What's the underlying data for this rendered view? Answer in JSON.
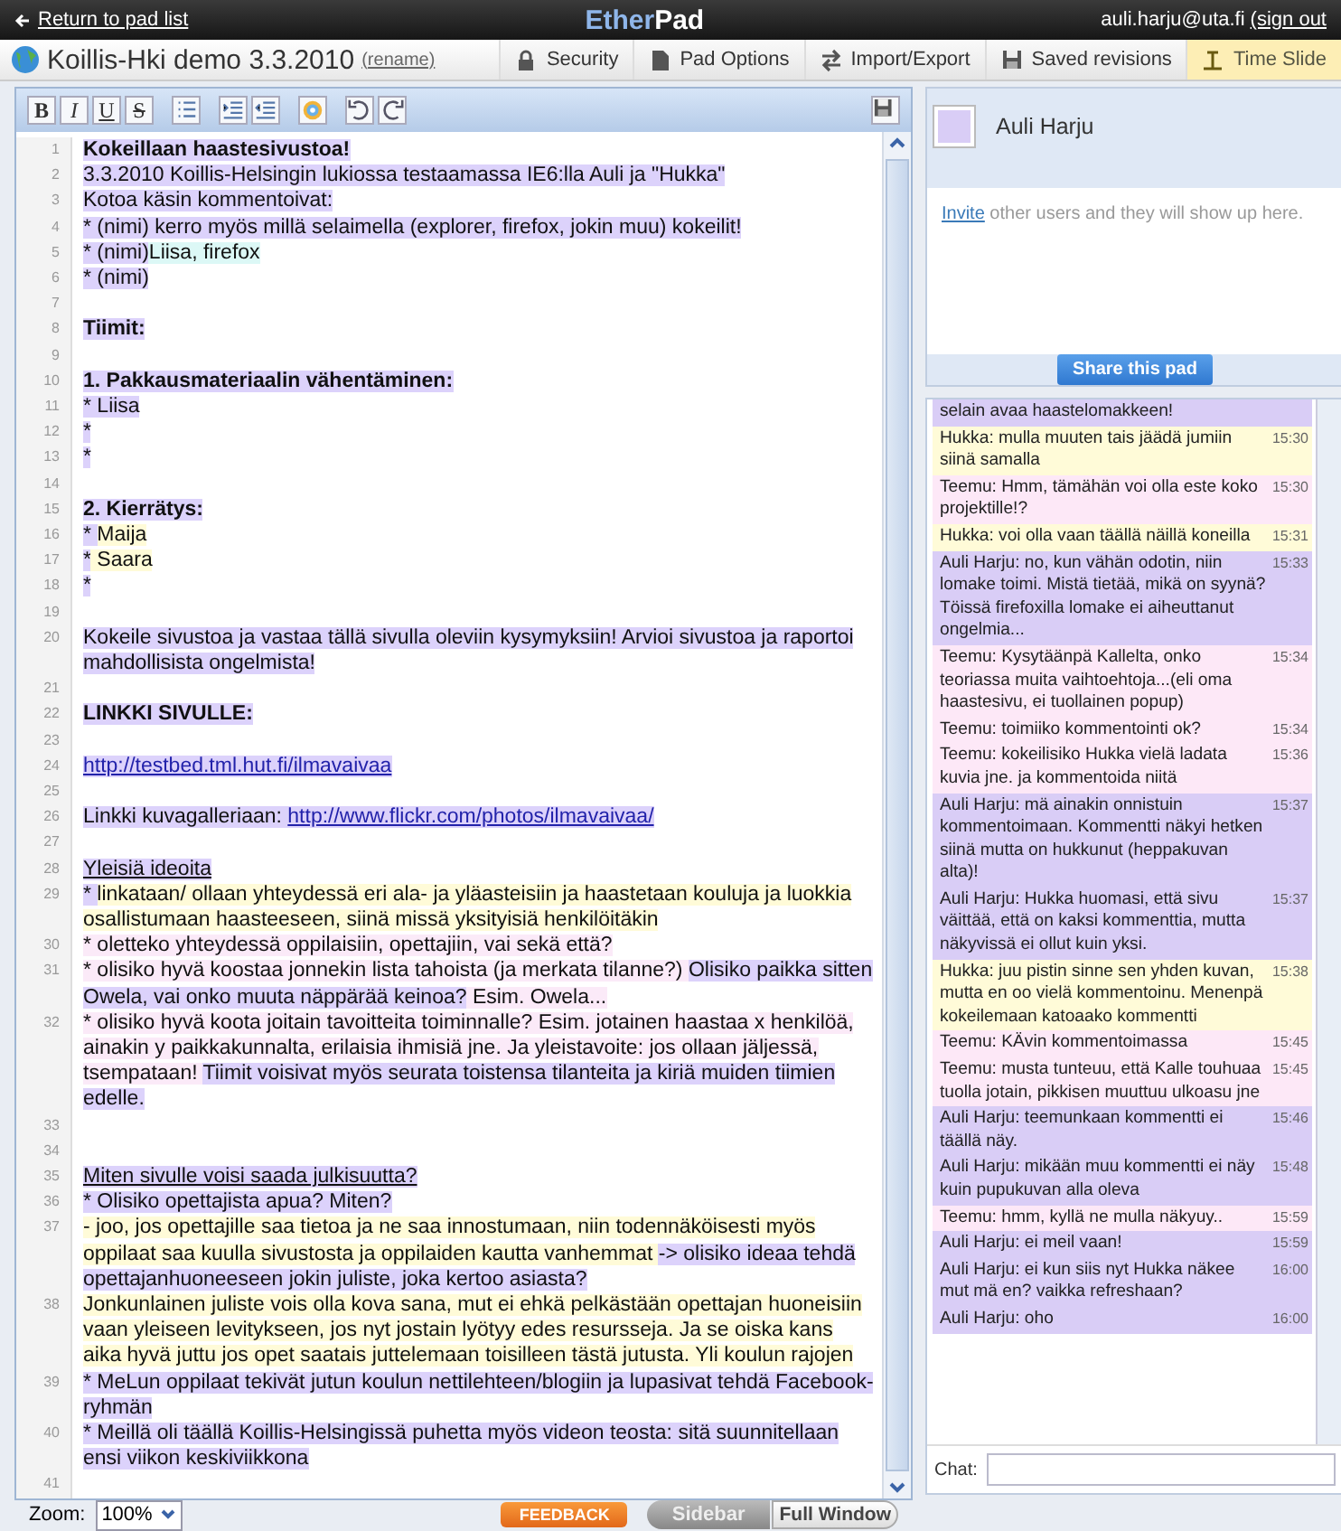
{
  "header": {
    "back_link": "Return to pad list",
    "logo_left": "Ether",
    "logo_right": "Pad",
    "user_email": "auli.harju@uta.fi",
    "sign_out": "(sign out"
  },
  "pad": {
    "title": "Koillis-Hki demo 3.3.2010",
    "rename": "(rename)"
  },
  "menu": [
    {
      "label": "Security",
      "kind": "lock",
      "selected": false
    },
    {
      "label": "Pad Options",
      "kind": "page",
      "selected": false
    },
    {
      "label": "Import/Export",
      "kind": "arrows",
      "selected": false
    },
    {
      "label": "Saved revisions",
      "kind": "floppy",
      "selected": false
    },
    {
      "label": "Time Slide",
      "kind": "slider",
      "selected": true
    }
  ],
  "toolbar": [
    {
      "kind": "bold",
      "label": "B"
    },
    {
      "kind": "italic",
      "label": "I"
    },
    {
      "kind": "underline",
      "label": "U"
    },
    {
      "kind": "strike",
      "label": "S"
    },
    {
      "kind": "bullets"
    },
    {
      "kind": "indent"
    },
    {
      "kind": "outdent"
    },
    {
      "kind": "color"
    },
    {
      "kind": "undo"
    },
    {
      "kind": "redo"
    }
  ],
  "editor": {
    "lines": [
      {
        "number": "1",
        "segments": [
          {
            "text": "Kokeillaan haastesivustoa!",
            "kind": "bold",
            "color": "#dcd2fb"
          }
        ]
      },
      {
        "number": "2",
        "segments": [
          {
            "text": "3.3.2010 Koillis-Helsingin lukiossa testaamassa IE6:lla Auli ja \"Hukka\"",
            "kind": "plain",
            "color": "#dcd2fb"
          }
        ]
      },
      {
        "number": "3",
        "segments": [
          {
            "text": "Kotoa käsin kommentoivat:",
            "kind": "plain",
            "color": "#dcd2fb"
          }
        ]
      },
      {
        "number": "4",
        "segments": [
          {
            "text": "* (nimi) kerro myös millä selaimella (explorer, firefox, jokin muu) kokeilit!",
            "kind": "plain",
            "color": "#dcd2fb"
          }
        ]
      },
      {
        "number": "5",
        "segments": [
          {
            "text": "* (nimi)",
            "kind": "plain",
            "color": "#dcd2fb"
          },
          {
            "text": "Liisa, firefox",
            "kind": "plain",
            "color": "#dcf8f6"
          }
        ]
      },
      {
        "number": "6",
        "segments": [
          {
            "text": "* (nimi)",
            "kind": "plain",
            "color": "#dcd2fb"
          }
        ]
      },
      {
        "number": "7"
      },
      {
        "number": "8",
        "segments": [
          {
            "text": "Tiimit:",
            "kind": "bold",
            "color": "#dcd2fb"
          }
        ]
      },
      {
        "number": "9"
      },
      {
        "number": "10",
        "segments": [
          {
            "text": "1. Pakkausmateriaalin vähentäminen:",
            "kind": "bold",
            "color": "#dcd2fb"
          }
        ]
      },
      {
        "number": "11",
        "segments": [
          {
            "text": "* Liisa",
            "kind": "plain",
            "color": "#dcd2fb"
          }
        ]
      },
      {
        "number": "12",
        "segments": [
          {
            "text": "*",
            "kind": "plain",
            "color": "#dcd2fb"
          }
        ]
      },
      {
        "number": "13",
        "segments": [
          {
            "text": "*",
            "kind": "plain",
            "color": "#dcd2fb"
          }
        ]
      },
      {
        "number": "14"
      },
      {
        "number": "15",
        "segments": [
          {
            "text": "2. Kierrätys:",
            "kind": "bold",
            "color": "#dcd2fb"
          }
        ]
      },
      {
        "number": "16",
        "segments": [
          {
            "text": "* ",
            "kind": "plain",
            "color": "#dcd2fb"
          },
          {
            "text": "Maija",
            "kind": "plain",
            "color": "#fffbd8"
          }
        ]
      },
      {
        "number": "17",
        "segments": [
          {
            "text": "*",
            "kind": "plain",
            "color": "#dcd2fb"
          },
          {
            "text": " Saara",
            "kind": "plain",
            "color": "#fffbd8"
          }
        ]
      },
      {
        "number": "18",
        "segments": [
          {
            "text": "*",
            "kind": "plain",
            "color": "#dcd2fb"
          }
        ]
      },
      {
        "number": "19"
      },
      {
        "number": "20",
        "segments": [
          {
            "text": "Kokeile sivustoa ja vastaa tällä sivulla oleviin kysymyksiin! Arvioi sivustoa ja raportoi mahdollisista ongelmista!",
            "kind": "plain",
            "color": "#dcd2fb"
          }
        ]
      },
      {
        "number": "21"
      },
      {
        "number": "22",
        "segments": [
          {
            "text": "LINKKI SIVULLE:",
            "kind": "bold",
            "color": "#dcd2fb"
          }
        ]
      },
      {
        "number": "23"
      },
      {
        "number": "24",
        "segments": [
          {
            "text": "http://testbed.tml.hut.fi/ilmavaivaa",
            "kind": "link",
            "color": "#dcd2fb"
          }
        ]
      },
      {
        "number": "25"
      },
      {
        "number": "26",
        "segments": [
          {
            "text": "Linkki kuvagalleriaan: ",
            "kind": "plain",
            "color": "#dcd2fb"
          },
          {
            "text": "http://www.flickr.com/photos/ilmavaivaa/",
            "kind": "link",
            "color": "#dcd2fb"
          }
        ]
      },
      {
        "number": "27"
      },
      {
        "number": "28",
        "segments": [
          {
            "text": "Yleisiä ideoita",
            "kind": "underline",
            "color": "#dcd2fb"
          }
        ]
      },
      {
        "number": "29",
        "segments": [
          {
            "text": "* ",
            "kind": "plain",
            "color": "#dcd2fb"
          },
          {
            "text": "linkataan/ ollaan yhteydessä eri ala- ja yläasteisiin ja haastetaan kouluja ja luokkia osallistumaan haasteeseen, siinä missä yksityisiä henkilöitäkin",
            "kind": "plain",
            "color": "#fffbd8"
          }
        ]
      },
      {
        "number": "30",
        "segments": [
          {
            "text": "* oletteko yhteydessä oppilaisiin, opettajiin, vai sekä että?",
            "kind": "plain",
            "color": "#fbeaf8"
          }
        ]
      },
      {
        "number": "31",
        "segments": [
          {
            "text": "* olisiko hyvä koostaa jonnekin lista tahoista (ja merkata tilanne?) ",
            "kind": "plain",
            "color": "#fbeaf8"
          },
          {
            "text": "Olisiko paikka sitten Owela, vai onko muuta näppärää keinoa?",
            "kind": "plain",
            "color": "#dcd2fb"
          },
          {
            "text": " Esim. Owela...",
            "kind": "plain",
            "color": "#fbeaf8"
          }
        ]
      },
      {
        "number": "32",
        "segments": [
          {
            "text": "* olisiko hyvä koota joitain tavoitteita toiminnalle? Esim. jotainen haastaa x henkilöä, ainakin y paikkakunnalta, erilaisia ihmisiä jne. Ja yleistavoite: jos ollaan jäljessä, tsempataan! ",
            "kind": "plain",
            "color": "#fbeaf8"
          },
          {
            "text": "Tiimit voisivat myös seurata toistensa tilanteita ja kiriä muiden tiimien edelle.",
            "kind": "plain",
            "color": "#dcd2fb"
          }
        ]
      },
      {
        "number": "33"
      },
      {
        "number": "34"
      },
      {
        "number": "35",
        "segments": [
          {
            "text": "Miten sivulle voisi saada julkisuutta?",
            "kind": "underline",
            "color": "#dcd2fb"
          }
        ]
      },
      {
        "number": "36",
        "segments": [
          {
            "text": "* Olisiko opettajista apua? Miten?",
            "kind": "plain",
            "color": "#dcd2fb"
          }
        ]
      },
      {
        "number": "37",
        "segments": [
          {
            "text": "- joo, jos opettajille saa tietoa ja ne saa innostumaan, niin todennäköisesti myös oppilaat saa kuulla sivustosta ja oppilaiden kautta vanhemmat ",
            "kind": "plain",
            "color": "#fffbd8"
          },
          {
            "text": "-> olisiko ideaa tehdä opettajanhuoneeseen jokin juliste, joka kertoo asiasta?",
            "kind": "plain",
            "color": "#dcd2fb"
          }
        ]
      },
      {
        "number": "38",
        "segments": [
          {
            "text": "Jonkunlainen juliste vois olla kova sana, mut ei ehkä pelkästään opettajan huoneisiin vaan yleiseen levitykseen, jos nyt jostain lyötyy edes resursseja. Ja se oiska kans aika hyvä juttu jos opet saatais juttelemaan toisilleen tästä jutusta. Yli koulun rajojen",
            "kind": "plain",
            "color": "#fffbd8"
          }
        ]
      },
      {
        "number": "39",
        "segments": [
          {
            "text": "* MeLun oppilaat tekivät jutun koulun nettilehteen/blogiin ja lupasivat tehdä Facebook-ryhmän",
            "kind": "plain",
            "color": "#dcd2fb"
          }
        ]
      },
      {
        "number": "40",
        "segments": [
          {
            "text": "* Meillä oli täällä Koillis-Helsingissä puhetta myös videon teosta: sitä suunnitellaan ensi viikon keskiviikkona",
            "kind": "plain",
            "color": "#dcd2fb"
          }
        ]
      },
      {
        "number": "41"
      }
    ]
  },
  "footer": {
    "zoom_label": "Zoom:",
    "zoom_value": "100%",
    "feedback": "FEEDBACK",
    "sidebar": "Sidebar",
    "full_window": "Full Window"
  },
  "users": [
    {
      "name": "Auli Harju",
      "color": "#d9cdf6"
    }
  ],
  "invite": {
    "link": "Invite",
    "text": " other users and they will show up here."
  },
  "share_button": "Share this pad",
  "chat": {
    "messages": [
      {
        "text": "selain avaa haastelomakkeen!",
        "color": "#d9cdf6"
      },
      {
        "text": "Hukka: mulla muuten tais jäädä jumiin siinä samalla",
        "time": "15:30",
        "color": "#fffbd8"
      },
      {
        "text": "Teemu: Hmm, tämähän voi olla este koko projektille!?",
        "time": "15:30",
        "color": "#fde8f7"
      },
      {
        "text": "Hukka: voi olla vaan täällä näillä koneilla",
        "time": "15:31",
        "color": "#fffbd8"
      },
      {
        "text": "Auli Harju: no, kun vähän odotin, niin lomake toimi. Mistä tietää, mikä on syynä? Töissä firefoxilla lomake ei aiheuttanut ongelmia...",
        "time": "15:33",
        "color": "#d9cdf6"
      },
      {
        "text": "Teemu: Kysytäänpä Kallelta, onko teoriassa muita vaihtoehtoja...(eli oma haastesivu, ei tuollainen popup)",
        "time": "15:34",
        "color": "#fde8f7"
      },
      {
        "text": "Teemu: toimiiko kommentointi ok?",
        "time": "15:34",
        "color": "#fde8f7"
      },
      {
        "text": "Teemu: kokeilisiko Hukka vielä ladata kuvia jne. ja kommentoida niitä",
        "time": "15:36",
        "color": "#fde8f7"
      },
      {
        "text": "Auli Harju: mä ainakin onnistuin kommentoimaan. Kommentti näkyi hetken siinä mutta on hukkunut (heppakuvan alta)!",
        "time": "15:37",
        "color": "#d9cdf6"
      },
      {
        "text": "Auli Harju: Hukka huomasi, että sivu väittää, että on kaksi kommenttia, mutta näkyvissä ei ollut kuin yksi.",
        "time": "15:37",
        "color": "#d9cdf6"
      },
      {
        "text": "Hukka: juu pistin sinne sen yhden kuvan, mutta en oo vielä kommentoinu. Menenpä kokeilemaan katoaako kommentti",
        "time": "15:38",
        "color": "#fffbd8"
      },
      {
        "text": "Teemu: KÄvin kommentoimassa",
        "time": "15:45",
        "color": "#fde8f7"
      },
      {
        "text": "Teemu: musta tunteuu, että Kalle touhuaa tuolla jotain, pikkisen muuttuu ulkoasu jne",
        "time": "15:45",
        "color": "#fde8f7"
      },
      {
        "text": "Auli Harju: teemunkaan kommentti ei täällä näy.",
        "time": "15:46",
        "color": "#d9cdf6"
      },
      {
        "text": "Auli Harju: mikään muu kommentti ei näy kuin pupukuvan alla oleva",
        "time": "15:48",
        "color": "#d9cdf6"
      },
      {
        "text": "Teemu: hmm, kyllä ne mulla näkyuy..",
        "time": "15:59",
        "color": "#fde8f7"
      },
      {
        "text": "Auli Harju: ei meil vaan!",
        "time": "15:59",
        "color": "#d9cdf6"
      },
      {
        "text": "Auli Harju: ei kun siis nyt Hukka näkee mut mä en? vaikka refreshaan?",
        "time": "16:00",
        "color": "#d9cdf6"
      },
      {
        "text": "Auli Harju: oho",
        "time": "16:00",
        "color": "#d9cdf6"
      }
    ],
    "input_label": "Chat:"
  }
}
